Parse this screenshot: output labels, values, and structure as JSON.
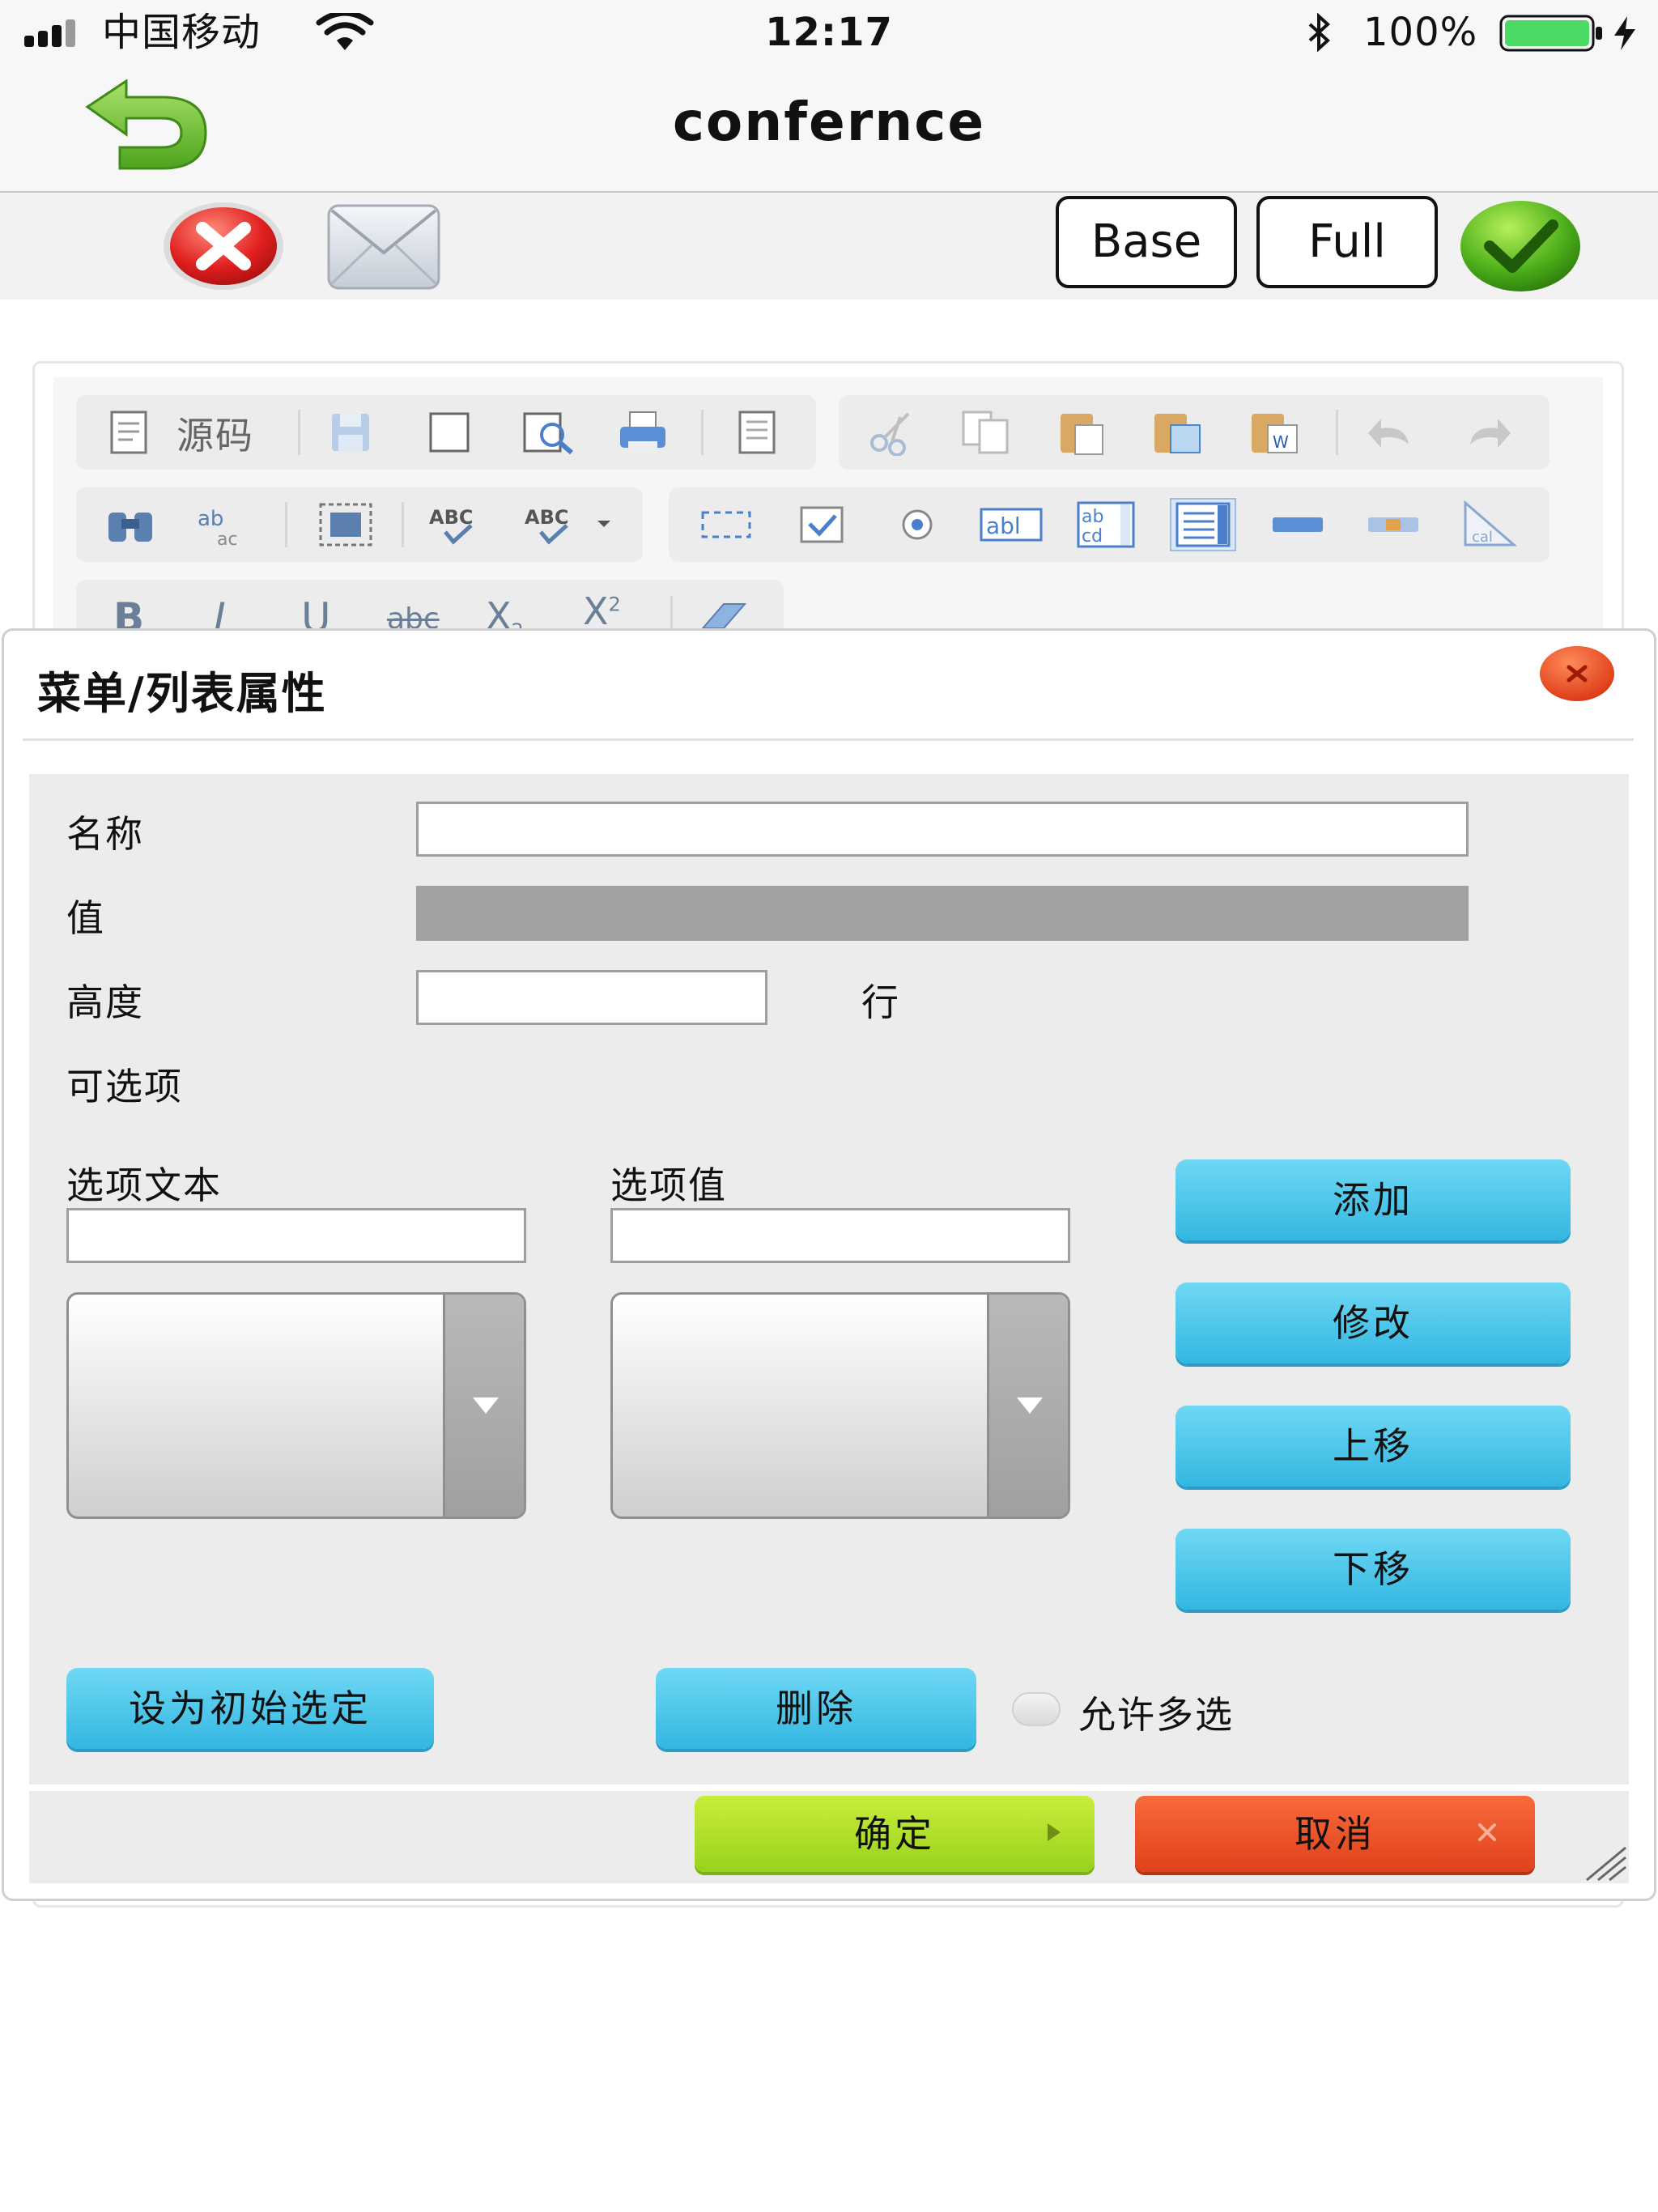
{
  "status_bar": {
    "carrier": "中国移动",
    "time": "12:17",
    "battery_percent": "100%",
    "battery_level": 1.0
  },
  "nav": {
    "title": "confernce"
  },
  "toolbar": {
    "base_label": "Base",
    "full_label": "Full"
  },
  "editor_toolbar": {
    "source_label": "源码"
  },
  "dialog": {
    "title": "菜单/列表属性",
    "fields": {
      "name_label": "名称",
      "name_value": "",
      "value_label": "值",
      "height_label": "高度",
      "height_value": "",
      "height_unit": "行",
      "options_label": "可选项",
      "option_text_label": "选项文本",
      "option_text_value": "",
      "option_value_label": "选项值",
      "option_value_value": ""
    },
    "buttons": {
      "add": "添加",
      "modify": "修改",
      "move_up": "上移",
      "move_down": "下移",
      "set_initial": "设为初始选定",
      "delete": "删除",
      "ok": "确定",
      "cancel": "取消"
    },
    "allow_multi_label": "允许多选",
    "allow_multi_checked": false
  },
  "colors": {
    "accent_blue": "#3fbfe6",
    "ok_green": "#a8dc22",
    "cancel_red": "#ea4a22"
  }
}
